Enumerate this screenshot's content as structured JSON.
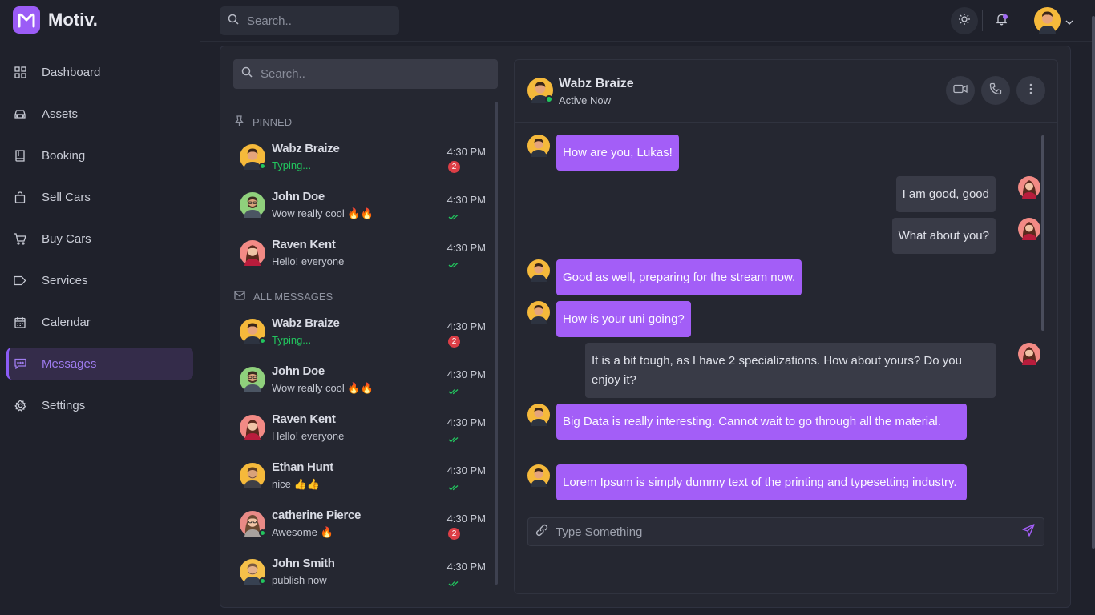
{
  "app": {
    "name": "Motiv.",
    "logo_letter": "M",
    "accent": "#9b5cf6"
  },
  "sidebar": {
    "items": [
      {
        "label": "Dashboard",
        "icon": "grid-icon"
      },
      {
        "label": "Assets",
        "icon": "car-icon"
      },
      {
        "label": "Booking",
        "icon": "book-icon"
      },
      {
        "label": "Sell Cars",
        "icon": "bag-icon"
      },
      {
        "label": "Buy Cars",
        "icon": "cart-icon"
      },
      {
        "label": "Services",
        "icon": "tag-icon"
      },
      {
        "label": "Calendar",
        "icon": "calendar-icon"
      },
      {
        "label": "Messages",
        "icon": "message-icon",
        "active": true
      },
      {
        "label": "Settings",
        "icon": "gear-icon"
      }
    ]
  },
  "topbar": {
    "search_placeholder": "Search.."
  },
  "chat_list": {
    "search_placeholder": "Search..",
    "pinned_label": "PINNED",
    "all_label": "ALL MESSAGES",
    "pinned": [
      {
        "name": "Wabz Braize",
        "preview": "Typing...",
        "time": "4:30 PM",
        "unread": "2",
        "typing": true,
        "online": true
      },
      {
        "name": "John Doe",
        "preview": "Wow really cool 🔥🔥",
        "time": "4:30 PM",
        "read": true
      },
      {
        "name": "Raven Kent",
        "preview": "Hello! everyone",
        "time": "4:30 PM",
        "read": true
      }
    ],
    "all": [
      {
        "name": "Wabz Braize",
        "preview": "Typing...",
        "time": "4:30 PM",
        "unread": "2",
        "typing": true,
        "online": true
      },
      {
        "name": "John Doe",
        "preview": "Wow really cool 🔥🔥",
        "time": "4:30 PM",
        "read": true
      },
      {
        "name": "Raven Kent",
        "preview": "Hello! everyone",
        "time": "4:30 PM",
        "read": true
      },
      {
        "name": "Ethan Hunt",
        "preview": "nice 👍👍",
        "time": "4:30 PM",
        "read": true
      },
      {
        "name": "catherine Pierce",
        "preview": "Awesome 🔥",
        "time": "4:30 PM",
        "unread": "2",
        "online": true
      },
      {
        "name": "John Smith",
        "preview": "publish now",
        "time": "4:30 PM",
        "read": true,
        "online": true
      }
    ]
  },
  "conversation": {
    "contact_name": "Wabz Braize",
    "contact_status": "Active Now",
    "messages": [
      {
        "dir": "in",
        "text": "How are you, Lukas!"
      },
      {
        "dir": "out",
        "text": "I am good, good"
      },
      {
        "dir": "out",
        "text": "What about you?"
      },
      {
        "dir": "in",
        "text": "Good as well, preparing for the stream now."
      },
      {
        "dir": "in",
        "text": "How is your uni going?"
      },
      {
        "dir": "out",
        "text": "It is a bit tough, as I have 2 specializations. How about yours? Do you enjoy it?"
      },
      {
        "dir": "in",
        "text": "Big Data is really interesting. Cannot wait to go through all the material."
      },
      {
        "dir": "in",
        "text": "Lorem Ipsum is simply dummy text of the printing and typesetting industry."
      }
    ],
    "composer_placeholder": "Type Something"
  }
}
